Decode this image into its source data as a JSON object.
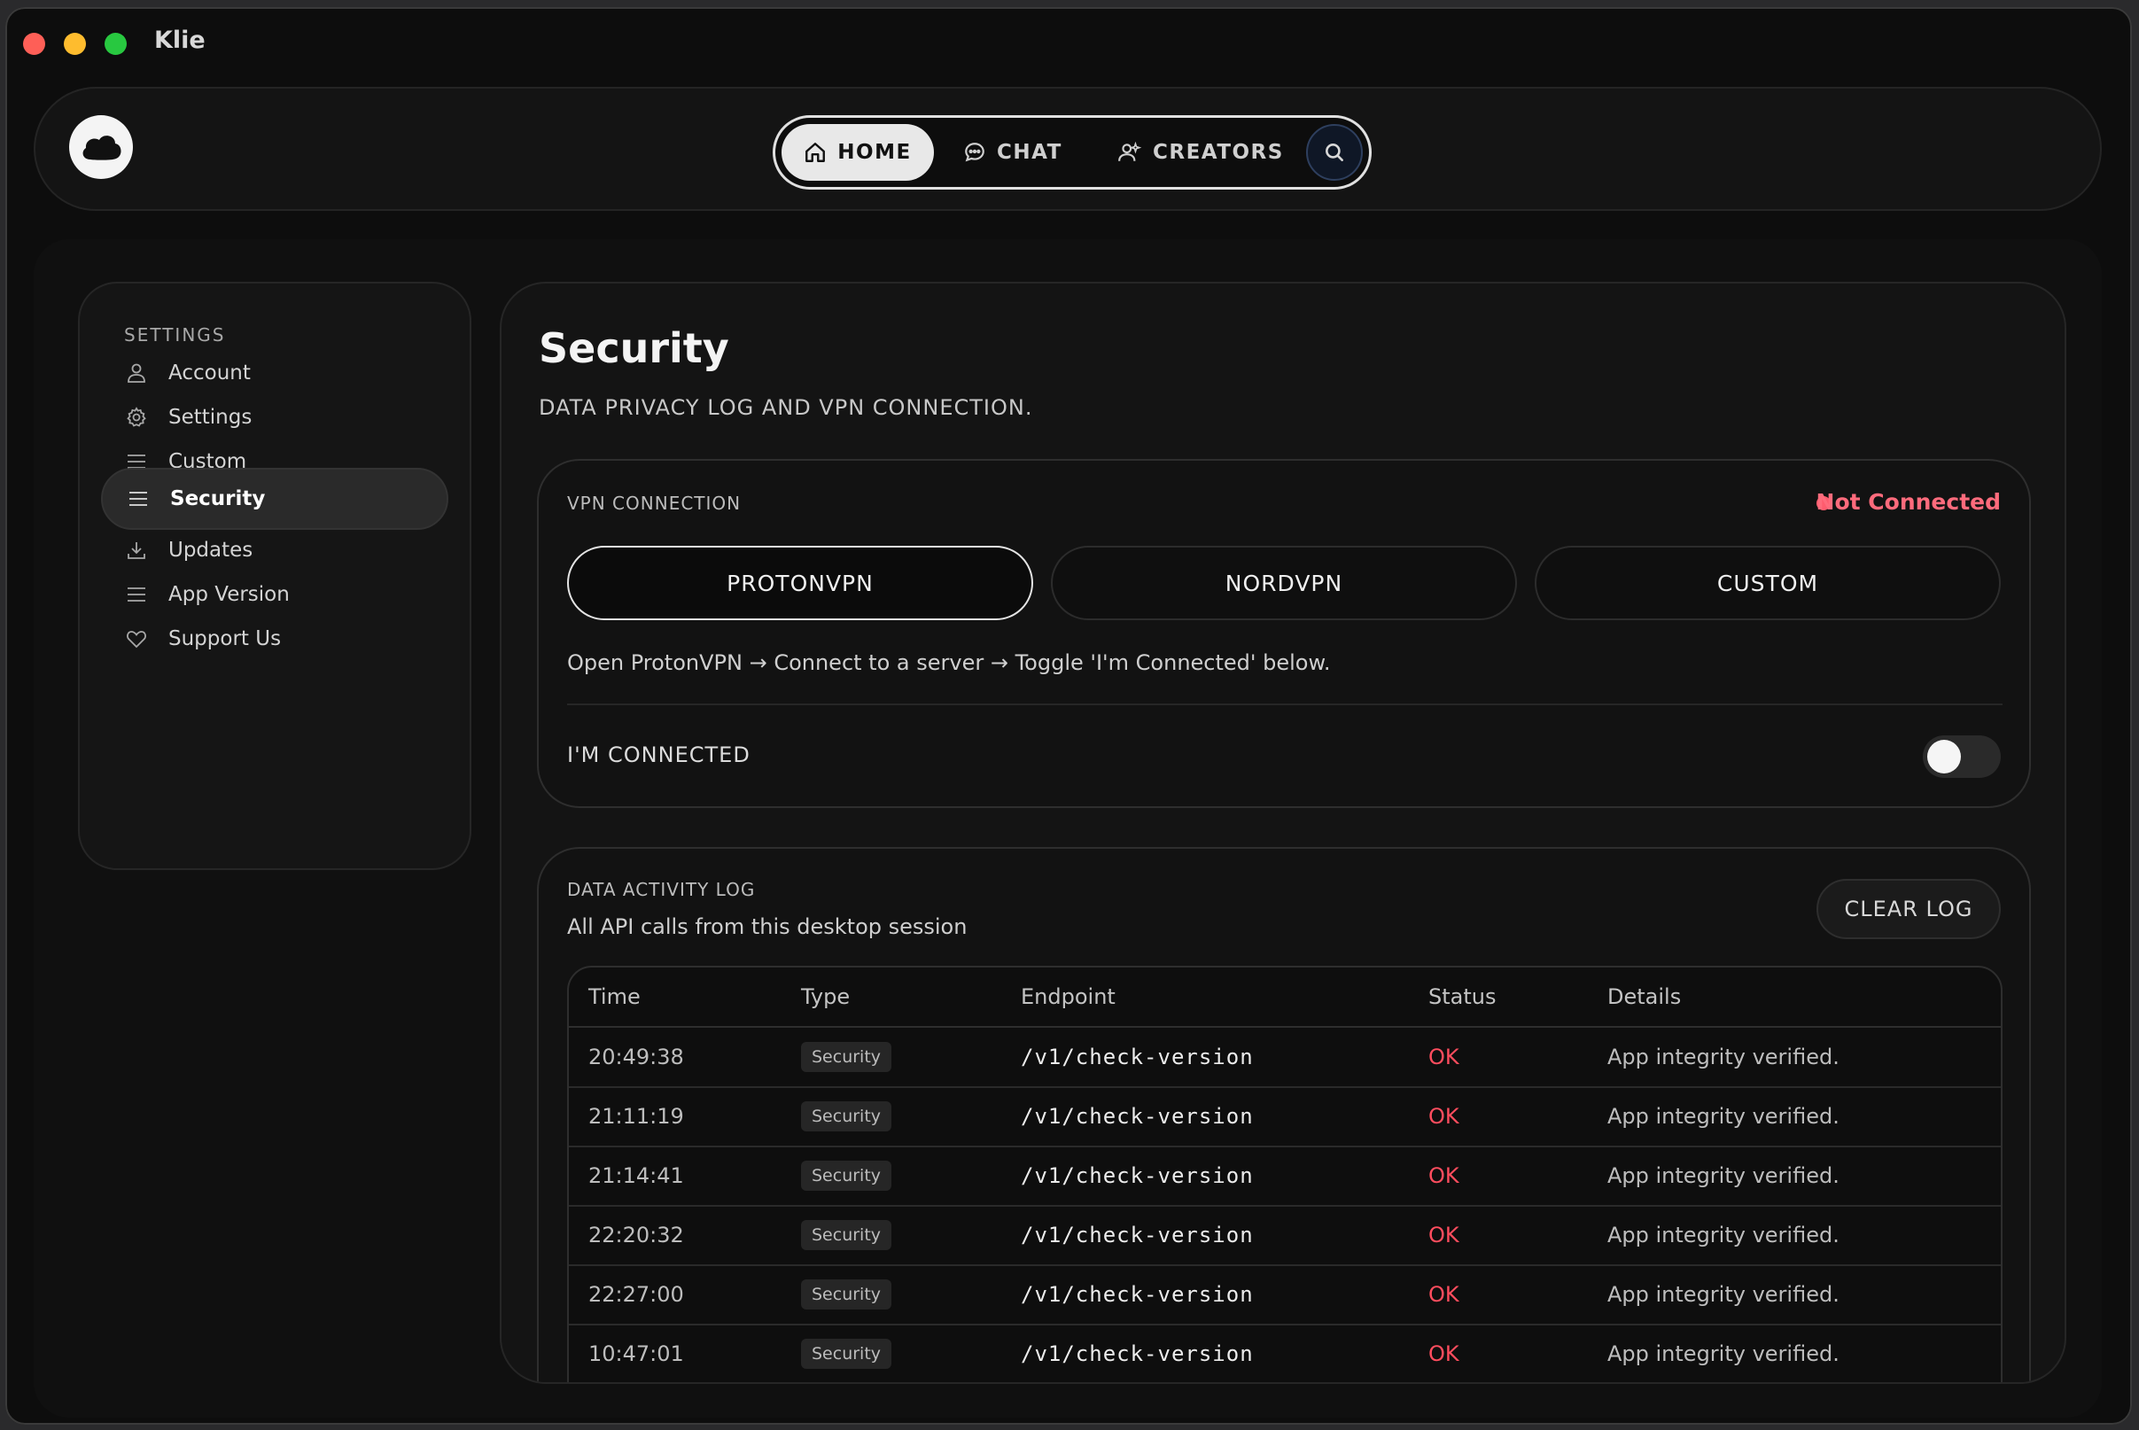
{
  "window": {
    "title": "Klie"
  },
  "nav": {
    "home_label": "HOME",
    "chat_label": "CHAT",
    "creators_label": "CREATORS"
  },
  "sidebar": {
    "heading": "SETTINGS",
    "items": [
      {
        "label": "Account",
        "icon": "user-icon"
      },
      {
        "label": "Settings",
        "icon": "gear-icon"
      },
      {
        "label": "Custom",
        "icon": "menu-icon"
      },
      {
        "label": "Security",
        "icon": "menu-icon",
        "active": true
      },
      {
        "label": "Updates",
        "icon": "download-icon"
      },
      {
        "label": "App Version",
        "icon": "menu-icon"
      },
      {
        "label": "Support Us",
        "icon": "heart-icon"
      }
    ]
  },
  "page": {
    "title": "Security",
    "subtitle": "DATA PRIVACY LOG AND VPN CONNECTION."
  },
  "vpn": {
    "label": "VPN CONNECTION",
    "status": "Not Connected",
    "status_color": "#ff6b7c",
    "options": [
      "PROTONVPN",
      "NORDVPN",
      "CUSTOM"
    ],
    "selected": "PROTONVPN",
    "instructions": "Open ProtonVPN → Connect to a server → Toggle 'I'm Connected' below.",
    "connected_label": "I'M CONNECTED",
    "connected": false
  },
  "log": {
    "label": "DATA ACTIVITY LOG",
    "description": "All API calls from this desktop session",
    "clear_label": "CLEAR LOG",
    "columns": [
      "Time",
      "Type",
      "Endpoint",
      "Status",
      "Details"
    ],
    "rows": [
      {
        "time": "20:49:38",
        "type": "Security",
        "endpoint": "/v1/check-version",
        "status": "OK",
        "details": "App integrity verified."
      },
      {
        "time": "21:11:19",
        "type": "Security",
        "endpoint": "/v1/check-version",
        "status": "OK",
        "details": "App integrity verified."
      },
      {
        "time": "21:14:41",
        "type": "Security",
        "endpoint": "/v1/check-version",
        "status": "OK",
        "details": "App integrity verified."
      },
      {
        "time": "22:20:32",
        "type": "Security",
        "endpoint": "/v1/check-version",
        "status": "OK",
        "details": "App integrity verified."
      },
      {
        "time": "22:27:00",
        "type": "Security",
        "endpoint": "/v1/check-version",
        "status": "OK",
        "details": "App integrity verified."
      },
      {
        "time": "10:47:01",
        "type": "Security",
        "endpoint": "/v1/check-version",
        "status": "OK",
        "details": "App integrity verified."
      }
    ]
  }
}
